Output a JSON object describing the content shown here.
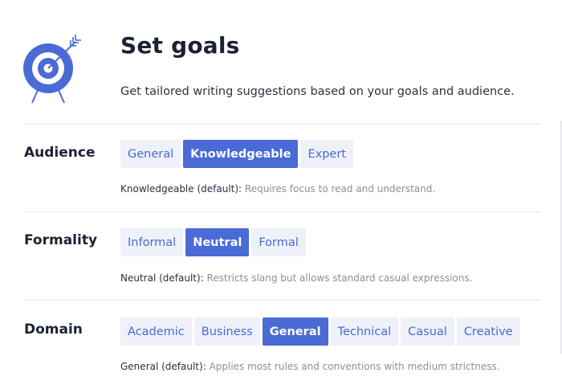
{
  "header": {
    "title": "Set goals",
    "subtitle": "Get tailored writing suggestions based on your goals and audience.",
    "icon": "target-icon"
  },
  "colors": {
    "accent": "#4a6ad6",
    "option_bg": "#eef1f8",
    "text_dark": "#1c2231",
    "text_muted": "#8a8f99"
  },
  "sections": {
    "audience": {
      "label": "Audience",
      "options": [
        "General",
        "Knowledgeable",
        "Expert"
      ],
      "selected": "Knowledgeable",
      "desc_key": "Knowledgeable (default):",
      "desc_text": " Requires focus to read and understand."
    },
    "formality": {
      "label": "Formality",
      "options": [
        "Informal",
        "Neutral",
        "Formal"
      ],
      "selected": "Neutral",
      "desc_key": "Neutral (default):",
      "desc_text": " Restricts slang but allows standard casual expressions."
    },
    "domain": {
      "label": "Domain",
      "options": [
        "Academic",
        "Business",
        "General",
        "Technical",
        "Casual",
        "Creative"
      ],
      "selected": "General",
      "desc_key": "General (default):",
      "desc_text": " Applies most rules and conventions with medium strictness."
    }
  }
}
